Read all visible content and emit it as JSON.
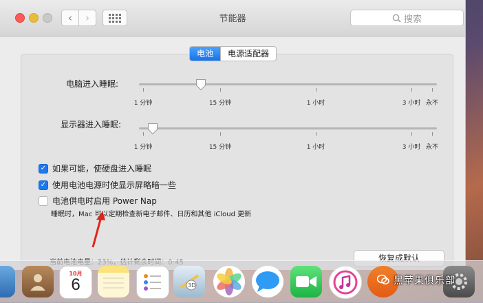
{
  "window": {
    "title": "节能器",
    "search_placeholder": "搜索"
  },
  "tabs": [
    {
      "label": "电池",
      "active": true
    },
    {
      "label": "电源适配器",
      "active": false
    }
  ],
  "computer_sleep": {
    "label": "电脑进入睡眠:",
    "ticks": [
      "1 分钟",
      "15 分钟",
      "1 小时",
      "3 小时",
      "永不"
    ],
    "value": "15 分钟"
  },
  "display_sleep": {
    "label": "显示器进入睡眠:",
    "ticks": [
      "1 分钟",
      "15 分钟",
      "1 小时",
      "3 小时",
      "永不"
    ],
    "value": "1 分钟"
  },
  "options": [
    {
      "label": "如果可能，使硬盘进入睡眠",
      "checked": true
    },
    {
      "label": "使用电池电源时使显示屏略暗一些",
      "checked": true
    },
    {
      "label": "电池供电时启用 Power Nap",
      "checked": false
    }
  ],
  "power_nap_note": "睡眠时，Mac 可以定期检查新电子邮件、日历和其他 iCloud 更新",
  "battery_status": "当前电池电量：23%，估计剩余时间：0:45",
  "restore_button": "恢复成默认",
  "dock": {
    "calendar_month": "10月",
    "calendar_day": "6"
  },
  "watermark": "黑苹果俱乐部",
  "colors": {
    "accent": "#1c78f0",
    "annotation_arrow": "#e0241b"
  }
}
